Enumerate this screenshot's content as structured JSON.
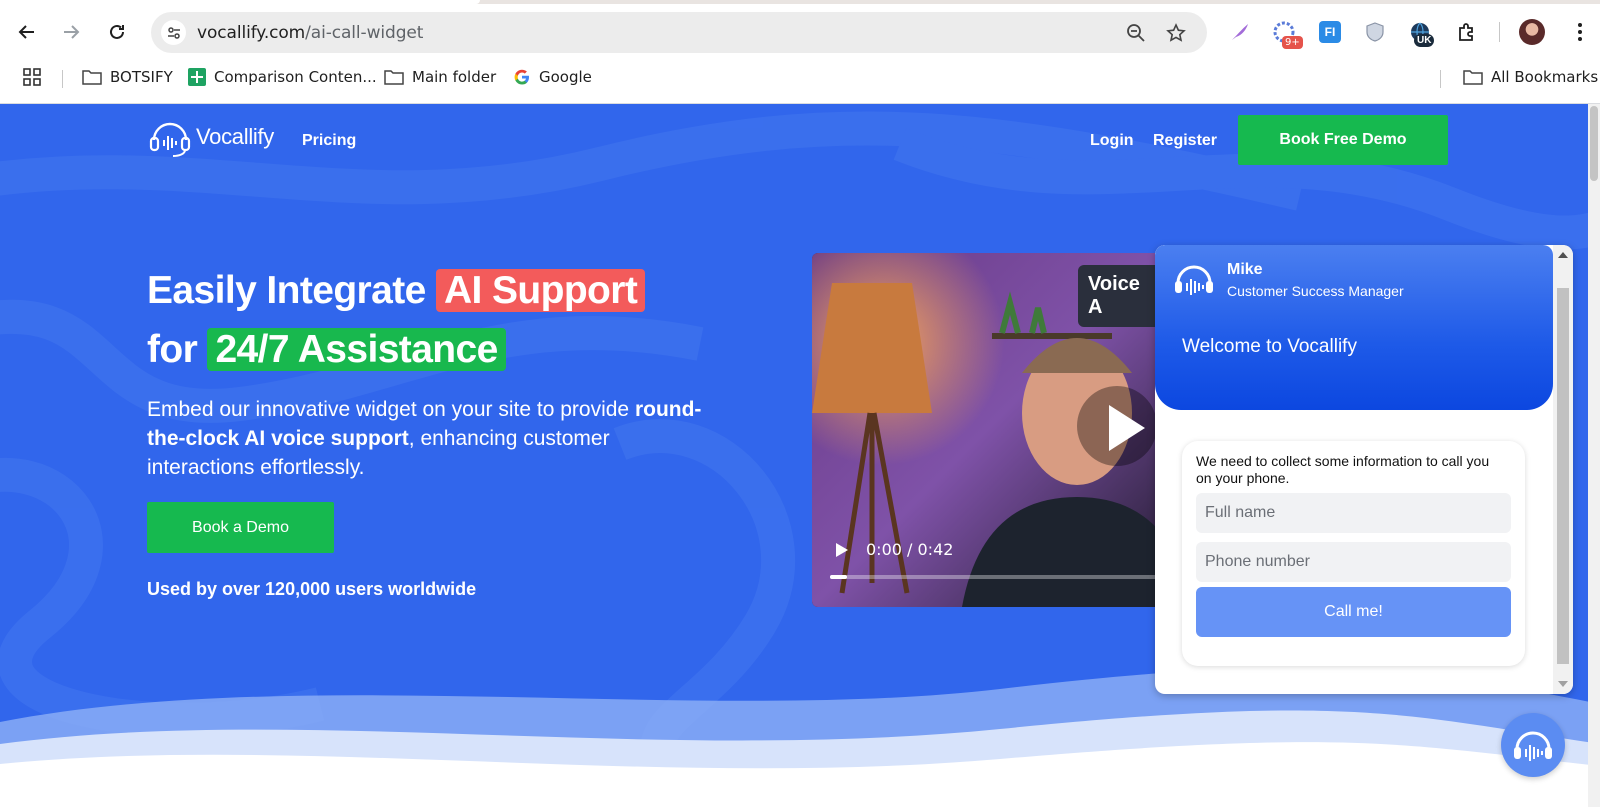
{
  "browser": {
    "url_host": "vocallify.com",
    "url_path": "/ai-call-widget",
    "extension_badge": "9+",
    "extension_fi_label": "FI",
    "extension_uk_label": "UK",
    "bookmarks": [
      {
        "label": "BOTSIFY",
        "icon": "folder-icon"
      },
      {
        "label": "Comparison Conten...",
        "icon": "sheets-icon"
      },
      {
        "label": "Main folder",
        "icon": "folder-icon"
      },
      {
        "label": "Google",
        "icon": "google-icon"
      }
    ],
    "all_bookmarks": "All Bookmarks"
  },
  "header": {
    "logo_text": "Vocallify",
    "pricing": "Pricing",
    "login": "Login",
    "register": "Register",
    "book_free_demo": "Book Free Demo"
  },
  "hero": {
    "title_part1": "Easily Integrate ",
    "title_highlight1": "AI Support",
    "title_part2": "for ",
    "title_highlight2": "24/7 Assistance",
    "sub_part1": "Embed our innovative widget on your site to provide ",
    "sub_bold": "round-the-clock AI voice support",
    "sub_part2": ", enhancing customer interactions effortlessly.",
    "book_demo": "Book a Demo",
    "used_by": "Used by over 120,000 users worldwide"
  },
  "video": {
    "label": "Voice A",
    "time": "0:00 / 0:42",
    "progress": 0.05
  },
  "widget": {
    "agent_name": "Mike",
    "agent_role": "Customer Success Manager",
    "welcome": "Welcome to Vocallify",
    "intro": "We need to collect some information to call you on your phone.",
    "full_name_placeholder": "Full name",
    "phone_placeholder": "Phone number",
    "call_button": "Call me!"
  },
  "colors": {
    "brand_blue": "#3166ec",
    "cta_green": "#16b94f",
    "highlight_red": "#f35b5b",
    "call_button": "#6693f6"
  }
}
